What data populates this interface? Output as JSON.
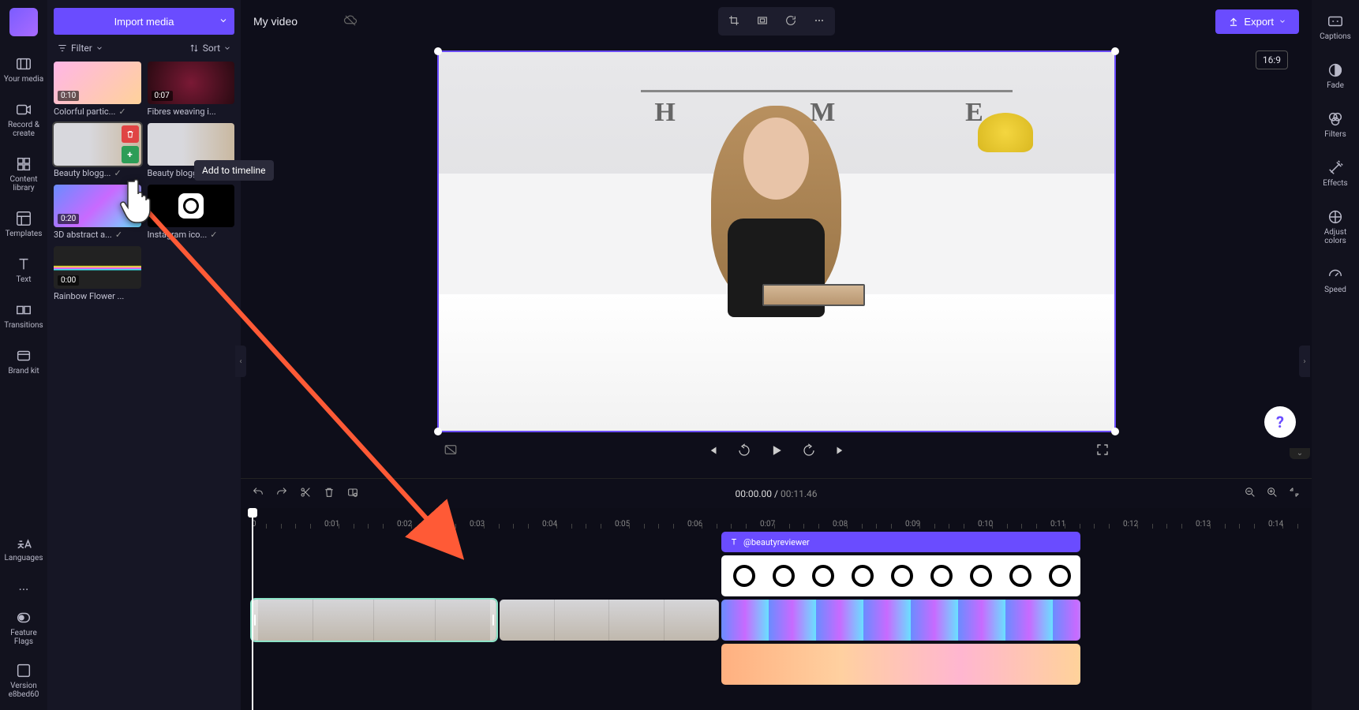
{
  "header": {
    "import_label": "Import media",
    "project_title": "My video",
    "export_label": "Export",
    "aspect": "16:9"
  },
  "leftRail": {
    "items": [
      "Your media",
      "Record & create",
      "Content library",
      "Templates",
      "Text",
      "Transitions",
      "Brand kit"
    ],
    "bottom": [
      "Languages",
      "...",
      "Feature Flags",
      "Version e8bed60"
    ]
  },
  "mediaPanel": {
    "filter": "Filter",
    "sort": "Sort",
    "tooltip": "Add to timeline",
    "items": [
      {
        "label": "Colorful partic...",
        "dur": "0:10",
        "check": true
      },
      {
        "label": "Fibres weaving i...",
        "dur": "0:07",
        "check": false
      },
      {
        "label": "Beauty blogg...",
        "dur": "",
        "check": true,
        "hover": true
      },
      {
        "label": "Beauty blogg...",
        "dur": "",
        "check": true
      },
      {
        "label": "3D abstract a...",
        "dur": "0:20",
        "check": true
      },
      {
        "label": "Instagram ico...",
        "dur": "",
        "check": true
      },
      {
        "label": "Rainbow Flower ...",
        "dur": "0:00",
        "check": false
      }
    ]
  },
  "rightRail": {
    "items": [
      "Captions",
      "Fade",
      "Filters",
      "Effects",
      "Adjust colors",
      "Speed"
    ]
  },
  "timeline": {
    "current": "00:00.00",
    "sep": " / ",
    "total": "00:11.46",
    "ticks": [
      "0",
      "0:01",
      "0:02",
      "0:03",
      "0:04",
      "0:05",
      "0:06",
      "0:07",
      "0:08",
      "0:09",
      "0:10",
      "0:11",
      "0:12",
      "0:13",
      "0:14"
    ],
    "text_clip": "@beautyreviewer"
  },
  "icons": {
    "filter": "filter",
    "sort": "sort",
    "crop": "crop",
    "fit": "fit",
    "rotate": "rotate",
    "more": "more",
    "prev": "prev",
    "back10": "back10",
    "play": "play",
    "fwd10": "fwd10",
    "next": "next",
    "fullscreen": "fullscreen",
    "pip": "pip",
    "undo": "undo",
    "redo": "redo",
    "cut": "cut",
    "delete": "delete",
    "split": "split",
    "zoomout": "zoomout",
    "zoomin": "zoomin",
    "fittl": "fit-timeline",
    "help": "?"
  }
}
